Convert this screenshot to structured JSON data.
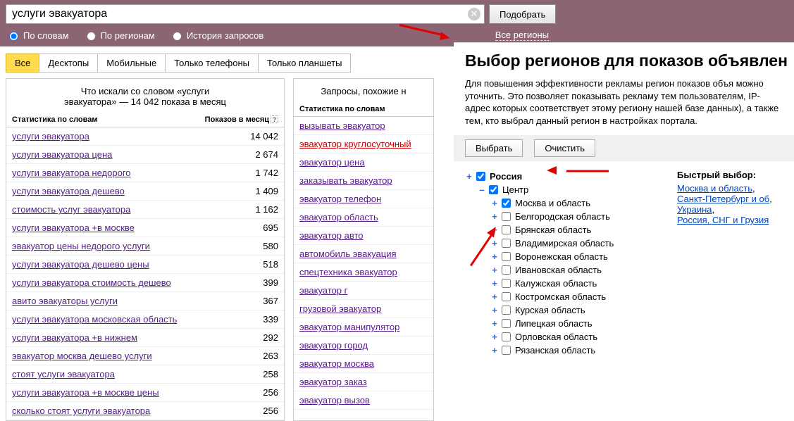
{
  "search": {
    "value": "услуги эвакуатора",
    "submit": "Подобрать"
  },
  "modes": {
    "by_words": "По словам",
    "by_regions": "По регионам",
    "history": "История запросов"
  },
  "region_link": "Все регионы",
  "device_tabs": [
    "Все",
    "Десктопы",
    "Мобильные",
    "Только телефоны",
    "Только планшеты"
  ],
  "left_panel": {
    "title_line1": "Что искали со словом «услуги",
    "title_line2": "эвакуатора» — 14 042 показа в месяц",
    "col1": "Статистика по словам",
    "col2": "Показов в месяц",
    "help": "?",
    "rows": [
      {
        "kw": "услуги эвакуатора",
        "n": "14 042"
      },
      {
        "kw": "услуги эвакуатора цена",
        "n": "2 674"
      },
      {
        "kw": "услуги эвакуатора недорого",
        "n": "1 742"
      },
      {
        "kw": "услуги эвакуатора дешево",
        "n": "1 409"
      },
      {
        "kw": "стоимость услуг эвакуатора",
        "n": "1 162"
      },
      {
        "kw": "услуги эвакуатора +в москве",
        "n": "695"
      },
      {
        "kw": "эвакуатор цены недорого услуги",
        "n": "580"
      },
      {
        "kw": "услуги эвакуатора дешево цены",
        "n": "518"
      },
      {
        "kw": "услуги эвакуатора стоимость дешево",
        "n": "399"
      },
      {
        "kw": "авито эвакуаторы услуги",
        "n": "367"
      },
      {
        "kw": "услуги эвакуатора московская область",
        "n": "339"
      },
      {
        "kw": "услуги эвакуатора +в нижнем",
        "n": "292"
      },
      {
        "kw": "эвакуатор москва дешево услуги",
        "n": "263"
      },
      {
        "kw": "стоят услуги эвакуатора",
        "n": "258"
      },
      {
        "kw": "услуги эвакуатора +в москве цены",
        "n": "256"
      },
      {
        "kw": "сколько стоят услуги эвакуатора",
        "n": "256"
      }
    ]
  },
  "right_panel": {
    "title": "Запросы, похожие н",
    "col1": "Статистика по словам",
    "rows": [
      {
        "kw": "вызывать эвакуатор"
      },
      {
        "kw": "эвакуатор круглосуточный",
        "red": true
      },
      {
        "kw": "эвакуатор цена"
      },
      {
        "kw": "заказывать эвакуатор"
      },
      {
        "kw": "эвакуатор телефон"
      },
      {
        "kw": "эвакуатор область"
      },
      {
        "kw": "эвакуатор авто"
      },
      {
        "kw": "автомобиль эвакуация"
      },
      {
        "kw": "спецтехника эвакуатор"
      },
      {
        "kw": "эвакуатор г"
      },
      {
        "kw": "грузовой эвакуатор"
      },
      {
        "kw": "эвакуатор манипулятор"
      },
      {
        "kw": "эвакуатор город"
      },
      {
        "kw": "эвакуатор москва"
      },
      {
        "kw": "эвакуатор заказ"
      },
      {
        "kw": "эвакуатор вызов"
      }
    ]
  },
  "popup": {
    "title": "Выбор регионов для показов объявлен",
    "desc": "Для повышения эффективности рекламы регион показов объя можно уточнить. Это позволяет показывать рекламу тем пользователям, IP-адрес которых соответствует этому региону нашей базе данных), а также тем, кто выбрал данный регион в настройках портала.",
    "select_btn": "Выбрать",
    "clear_btn": "Очистить",
    "tree": {
      "root": "Россия",
      "center": "Центр",
      "moscow": "Москва и область",
      "items": [
        "Белгородская область",
        "Брянская область",
        "Владимирская область",
        "Воронежская область",
        "Ивановская область",
        "Калужская область",
        "Костромская область",
        "Курская область",
        "Липецкая область",
        "Орловская область",
        "Рязанская область"
      ]
    },
    "quick": {
      "title": "Быстрый выбор:",
      "links": [
        "Москва и область",
        "Санкт-Петербург и об",
        "Украина",
        "Россия, СНГ и Грузия"
      ]
    }
  }
}
